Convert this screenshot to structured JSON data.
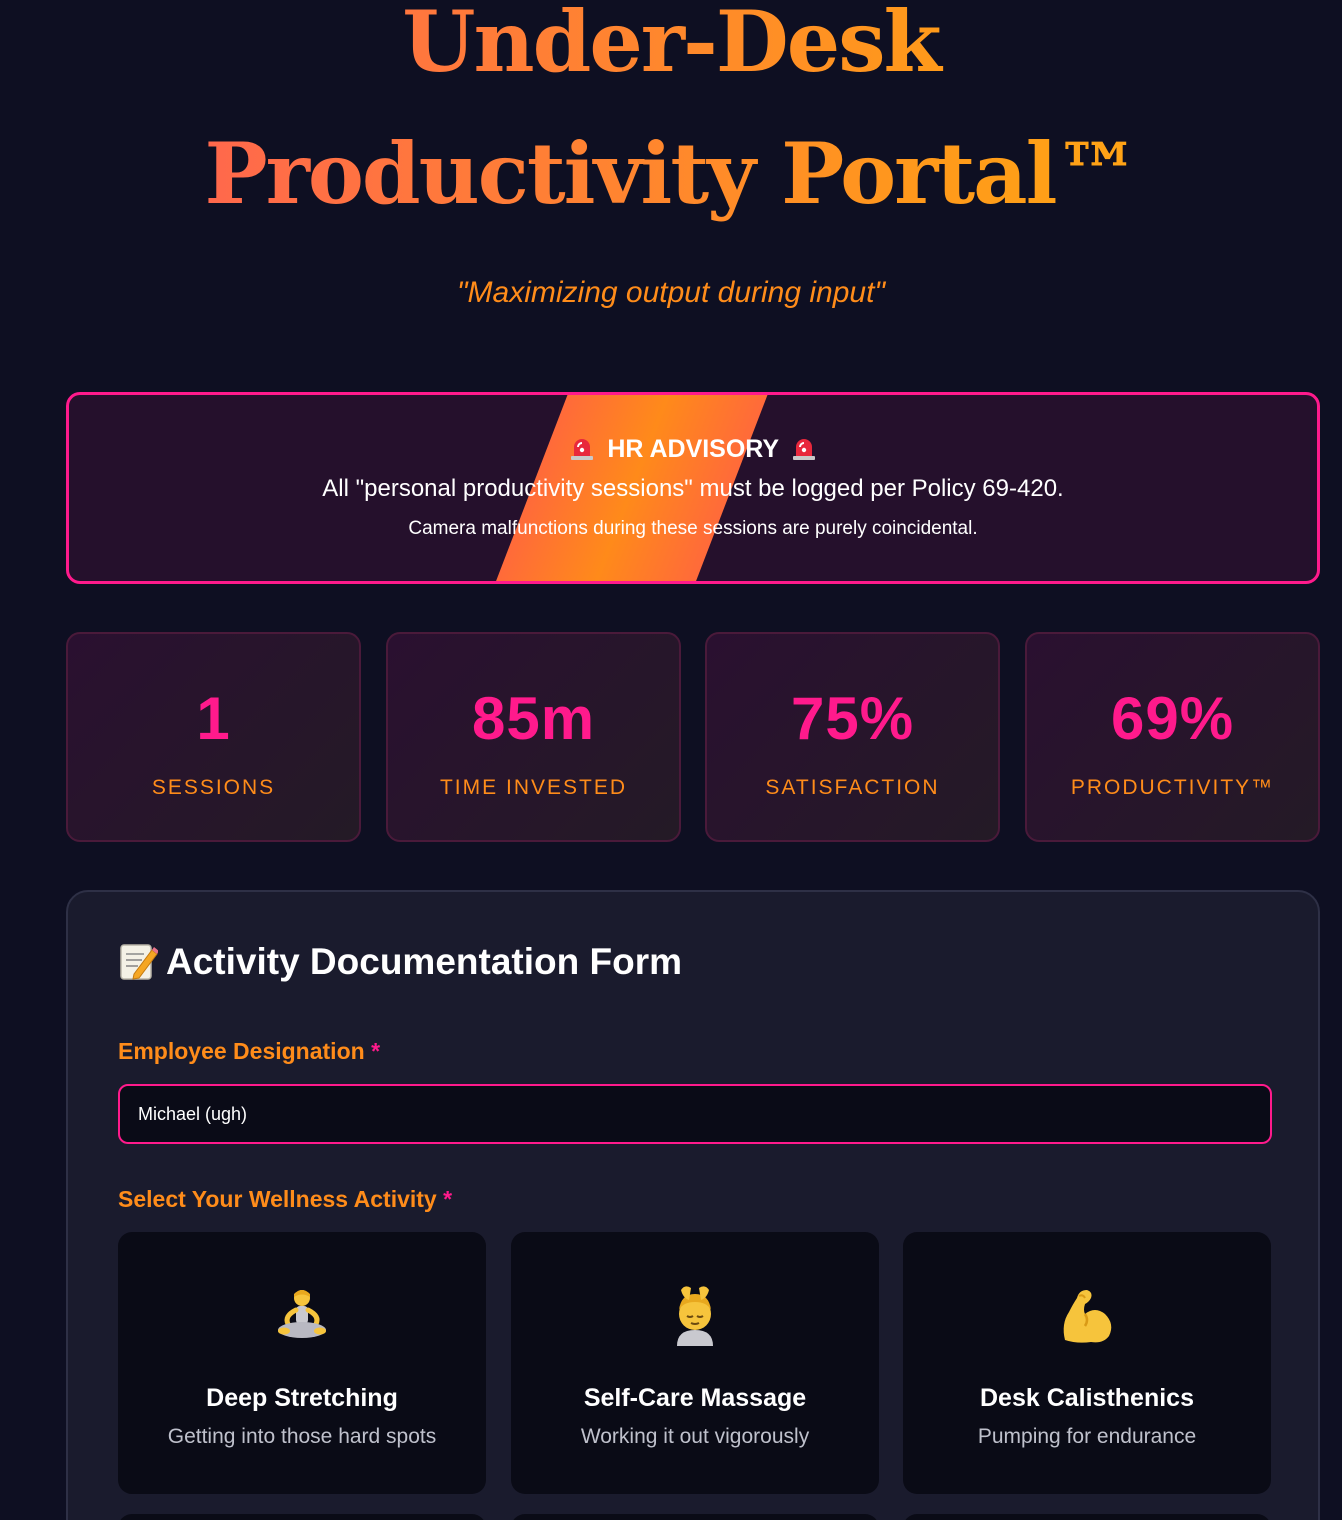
{
  "header": {
    "title": "Under-Desk Productivity Portal™",
    "tagline": "\"Maximizing output during input\""
  },
  "advisory": {
    "heading": "HR ADVISORY",
    "icon": "police-siren-icon",
    "line1": "All \"personal productivity sessions\" must be logged per Policy 69-420.",
    "line2": "Camera malfunctions during these sessions are purely coincidental."
  },
  "stats": [
    {
      "value": "1",
      "label": "SESSIONS"
    },
    {
      "value": "85m",
      "label": "TIME INVESTED"
    },
    {
      "value": "75%",
      "label": "SATISFACTION"
    },
    {
      "value": "69%",
      "label": "PRODUCTIVITY™"
    }
  ],
  "form": {
    "title": "Activity Documentation Form",
    "title_icon": "memo-icon",
    "employee_label": "Employee Designation",
    "required_marker": "*",
    "employee_value": "Michael (ugh)",
    "activity_label": "Select Your Wellness Activity",
    "activities": [
      {
        "name": "Deep Stretching",
        "desc": "Getting into those hard spots",
        "icon": "lotus-position-icon"
      },
      {
        "name": "Self-Care Massage",
        "desc": "Working it out vigorously",
        "icon": "face-massage-icon"
      },
      {
        "name": "Desk Calisthenics",
        "desc": "Pumping for endurance",
        "icon": "flexed-biceps-icon"
      }
    ]
  },
  "colors": {
    "background": "#0e0f22",
    "accent_pink": "#ff1a8c",
    "accent_orange": "#ff8c1a",
    "panel": "#1a1b2d",
    "card": "#0a0b16"
  }
}
